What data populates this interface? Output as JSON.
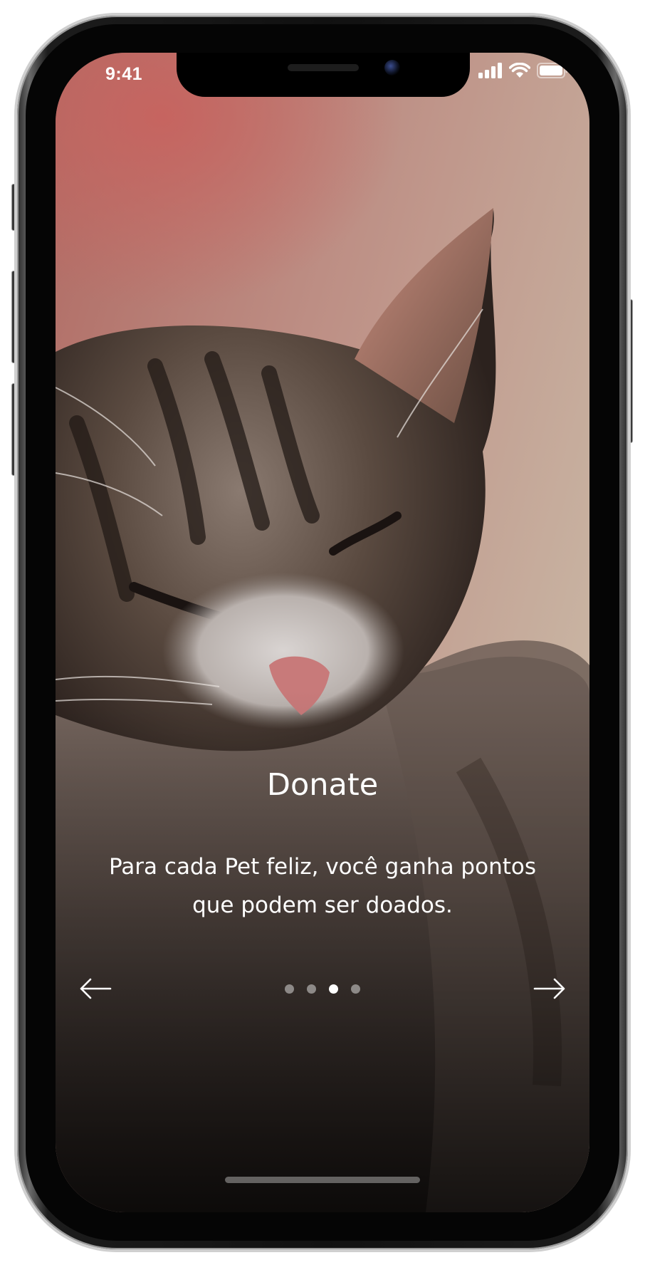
{
  "status_bar": {
    "time": "9:41",
    "icons": [
      "cellular-signal-icon",
      "wifi-icon",
      "battery-icon"
    ]
  },
  "onboarding": {
    "title": "Donate",
    "subtitle": "Para cada Pet feliz, você ganha pontos que podem ser doados.",
    "background_image": "sleeping-tabby-kitten-photo",
    "page_indicator": {
      "total": 4,
      "current": 3
    },
    "prev_icon": "arrow-left-icon",
    "next_icon": "arrow-right-icon"
  },
  "colors": {
    "text": "#ffffff",
    "dot_inactive": "#8e8a88",
    "dot_active": "#ffffff"
  }
}
